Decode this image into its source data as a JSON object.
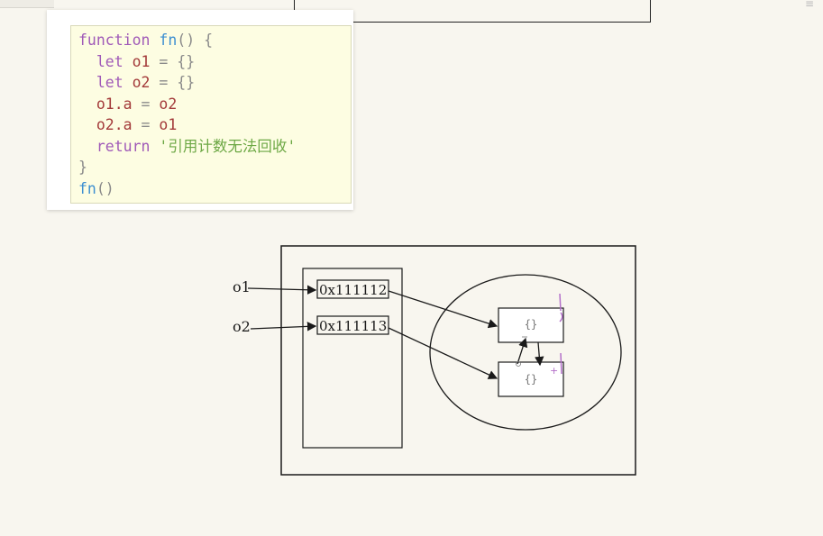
{
  "code": {
    "lines": [
      [
        {
          "t": "function",
          "c": "kw"
        },
        {
          "t": " ",
          "c": ""
        },
        {
          "t": "fn",
          "c": "fn"
        },
        {
          "t": "() {",
          "c": "op"
        }
      ],
      [
        {
          "t": "  let",
          "c": "kw"
        },
        {
          "t": " o1",
          "c": "vr"
        },
        {
          "t": " = {}",
          "c": "op"
        }
      ],
      [
        {
          "t": "  let",
          "c": "kw"
        },
        {
          "t": " o2",
          "c": "vr"
        },
        {
          "t": " = {}",
          "c": "op"
        }
      ],
      [
        {
          "t": "  o1.a",
          "c": "vr"
        },
        {
          "t": " = ",
          "c": "op"
        },
        {
          "t": "o2",
          "c": "vr"
        }
      ],
      [
        {
          "t": "  o2.a",
          "c": "vr"
        },
        {
          "t": " = ",
          "c": "op"
        },
        {
          "t": "o1",
          "c": "vr"
        }
      ],
      [
        {
          "t": "  return",
          "c": "kw"
        },
        {
          "t": " ",
          "c": ""
        },
        {
          "t": "'引用计数无法回收'",
          "c": "str"
        }
      ],
      [
        {
          "t": "}",
          "c": "op"
        }
      ],
      [
        {
          "t": "fn",
          "c": "fn"
        },
        {
          "t": "()",
          "c": "op"
        }
      ]
    ]
  },
  "diagram": {
    "var_o1": "o1",
    "var_o2": "o2",
    "addr_1": "0x111112",
    "addr_2": "0x111113",
    "obj_1": "{}",
    "obj_2": "{}",
    "plus_mark": "+"
  },
  "colors": {
    "ink": "#1a1a1a",
    "annotation": "#b36fc9"
  }
}
